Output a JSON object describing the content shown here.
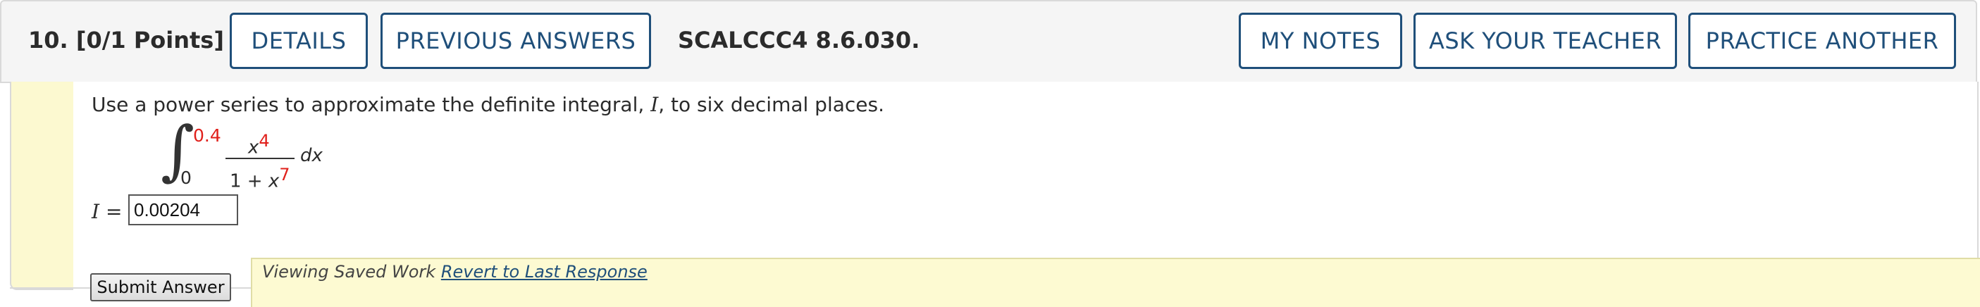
{
  "header": {
    "question_label": "10.  [0/1 Points]",
    "details_label": "DETAILS",
    "previous_answers_label": "PREVIOUS ANSWERS",
    "reference": "SCALCCC4 8.6.030.",
    "my_notes_label": "MY NOTES",
    "ask_teacher_label": "ASK YOUR TEACHER",
    "practice_another_label": "PRACTICE ANOTHER"
  },
  "problem": {
    "instruction_before": "Use a power series to approximate the definite integral, ",
    "instruction_var": "I",
    "instruction_after": ", to six decimal places.",
    "upper_limit": "0.4",
    "lower_limit": "0",
    "numerator_base": "x",
    "numerator_exp": "4",
    "denominator_base": "1 + ",
    "denominator_var": "x",
    "denominator_exp": "7",
    "differential": "dx"
  },
  "answer": {
    "label_var": "I",
    "label_eq": " = ",
    "value": "0.00204"
  },
  "footer": {
    "submit_label": "Submit Answer",
    "saved_text": "Viewing Saved Work ",
    "revert_link": "Revert to Last Response"
  },
  "colors": {
    "accent": "#1f4f7a",
    "highlight_red": "#e0201b",
    "panel_yellow": "#fcf9d0"
  }
}
